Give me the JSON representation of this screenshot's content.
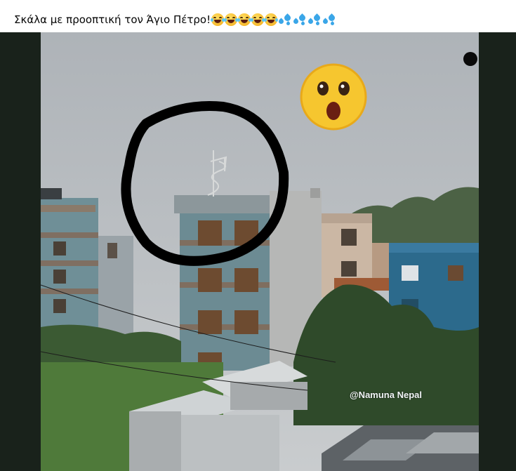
{
  "post": {
    "caption": "Σκάλα με προοπτική τον Άγιο Πέτρο!",
    "emojis": [
      "laughing-with-tears",
      "laughing-with-tears",
      "laughing-with-tears",
      "laughing-with-tears",
      "laughing-with-tears",
      "sweat-droplets",
      "sweat-droplets",
      "sweat-droplets",
      "sweat-droplets"
    ]
  },
  "image": {
    "watermark": "@Namuna Nepal",
    "overlay_emoji": "astonished-face-icon",
    "annotation": "hand-drawn-black-circle"
  }
}
